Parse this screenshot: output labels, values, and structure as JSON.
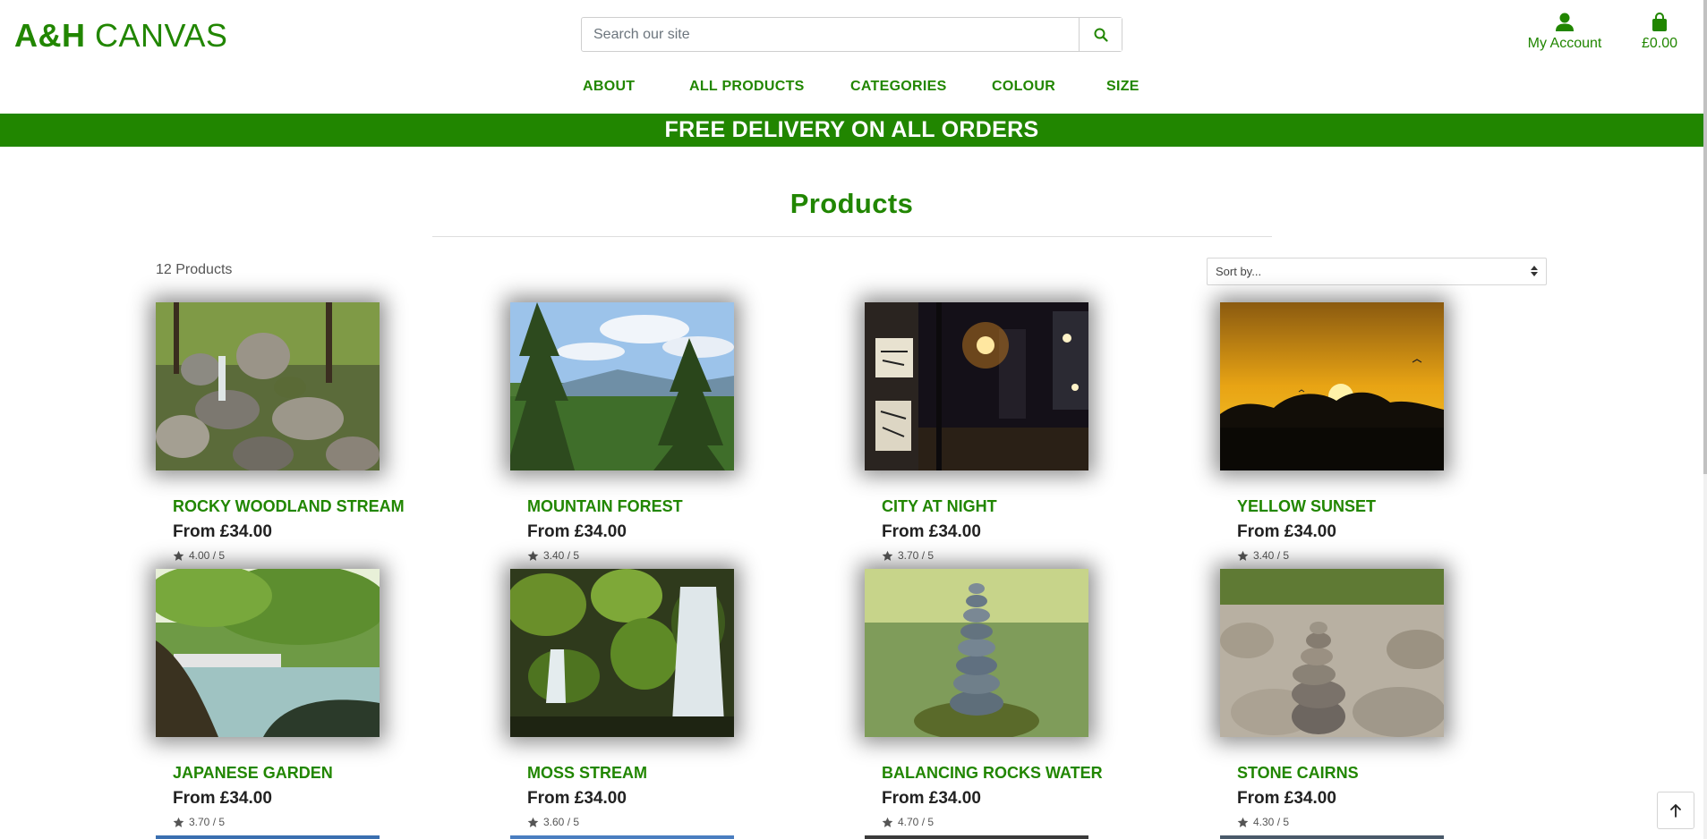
{
  "brand": {
    "logo_bold": "A&H",
    "logo_light": "CANVAS"
  },
  "search": {
    "placeholder": "Search our site",
    "value": ""
  },
  "header": {
    "account_label": "My Account",
    "basket_total": "£0.00"
  },
  "nav": {
    "items": [
      {
        "label": "ABOUT"
      },
      {
        "label": "ALL PRODUCTS"
      },
      {
        "label": "CATEGORIES"
      },
      {
        "label": "COLOUR"
      },
      {
        "label": "SIZE"
      }
    ]
  },
  "banner": {
    "text": "FREE DELIVERY ON ALL ORDERS"
  },
  "products": {
    "title": "Products",
    "count_label": "12 Products",
    "sort_label": "Sort by...",
    "items": [
      {
        "name": "ROCKY WOODLAND STREAM",
        "price": "From £34.00",
        "rating": "4.00 / 5",
        "image": "rocky-woodland-stream-photo"
      },
      {
        "name": "MOUNTAIN FOREST",
        "price": "From £34.00",
        "rating": "3.40 / 5",
        "image": "mountain-forest-photo"
      },
      {
        "name": "CITY AT NIGHT",
        "price": "From £34.00",
        "rating": "3.70 / 5",
        "image": "city-at-night-photo"
      },
      {
        "name": "YELLOW SUNSET",
        "price": "From £34.00",
        "rating": "3.40 / 5",
        "image": "yellow-sunset-photo"
      },
      {
        "name": "JAPANESE GARDEN",
        "price": "From £34.00",
        "rating": "3.70 / 5",
        "image": "japanese-garden-photo"
      },
      {
        "name": "MOSS STREAM",
        "price": "From £34.00",
        "rating": "3.60 / 5",
        "image": "moss-stream-photo"
      },
      {
        "name": "BALANCING ROCKS WATER",
        "price": "From £34.00",
        "rating": "4.70 / 5",
        "image": "balancing-rocks-water-photo"
      },
      {
        "name": "STONE CAIRNS",
        "price": "From £34.00",
        "rating": "4.30 / 5",
        "image": "stone-cairns-photo"
      }
    ]
  },
  "colors": {
    "brand_green": "#218600",
    "text_dark": "#222222",
    "muted": "#555555"
  },
  "icons": {
    "search": "search-icon",
    "account": "user-icon",
    "basket": "shopping-bag-icon",
    "rating": "star-icon",
    "sort": "sort-arrows-icon",
    "back_to_top": "arrow-up-icon"
  }
}
